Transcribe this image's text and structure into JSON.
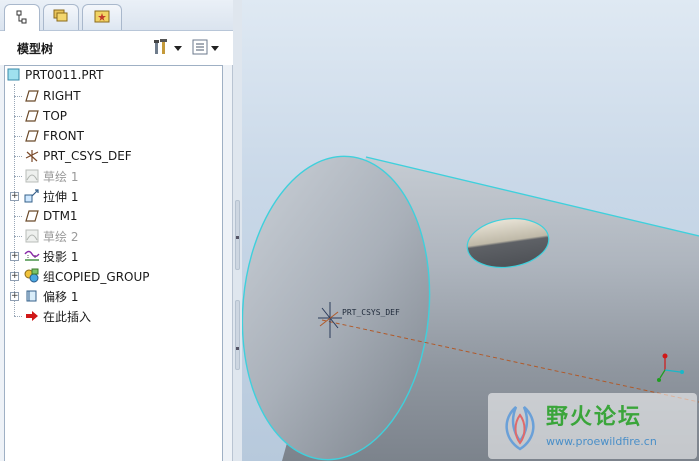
{
  "panel_tabs": [
    {
      "name": "model-tree-tab",
      "active": true
    },
    {
      "name": "folder-browser-tab",
      "active": false
    },
    {
      "name": "favorites-tab",
      "active": false
    }
  ],
  "model_tree": {
    "title": "模型树",
    "items": [
      {
        "label": "PRT0011.PRT",
        "icon": "part-icon",
        "dim": false
      },
      {
        "label": "RIGHT",
        "icon": "datum-plane-icon",
        "dim": false
      },
      {
        "label": "TOP",
        "icon": "datum-plane-icon",
        "dim": false
      },
      {
        "label": "FRONT",
        "icon": "datum-plane-icon",
        "dim": false
      },
      {
        "label": "PRT_CSYS_DEF",
        "icon": "csys-icon",
        "dim": false
      },
      {
        "label": "草绘 1",
        "icon": "sketch-icon",
        "dim": true
      },
      {
        "label": "拉伸 1",
        "icon": "extrude-icon",
        "dim": false,
        "expandable": true
      },
      {
        "label": "DTM1",
        "icon": "datum-plane-icon",
        "dim": false
      },
      {
        "label": "草绘 2",
        "icon": "sketch-icon",
        "dim": true
      },
      {
        "label": "投影 1",
        "icon": "projection-icon",
        "dim": false,
        "expandable": true
      },
      {
        "label": "组COPIED_GROUP",
        "icon": "group-icon",
        "dim": false,
        "expandable": true
      },
      {
        "label": "偏移 1",
        "icon": "offset-icon",
        "dim": false,
        "expandable": true
      },
      {
        "label": "在此插入",
        "icon": "insert-arrow-icon",
        "dim": false
      }
    ]
  },
  "viewport": {
    "csys_label": "PRT_CSYS_DEF",
    "watermark_cn": "野火论坛",
    "watermark_url": "www.proewildfire.cn"
  },
  "colors": {
    "edge_highlight": "#3fd0dc",
    "insert_arrow": "#d01818",
    "watermark": "#3aa53a"
  }
}
